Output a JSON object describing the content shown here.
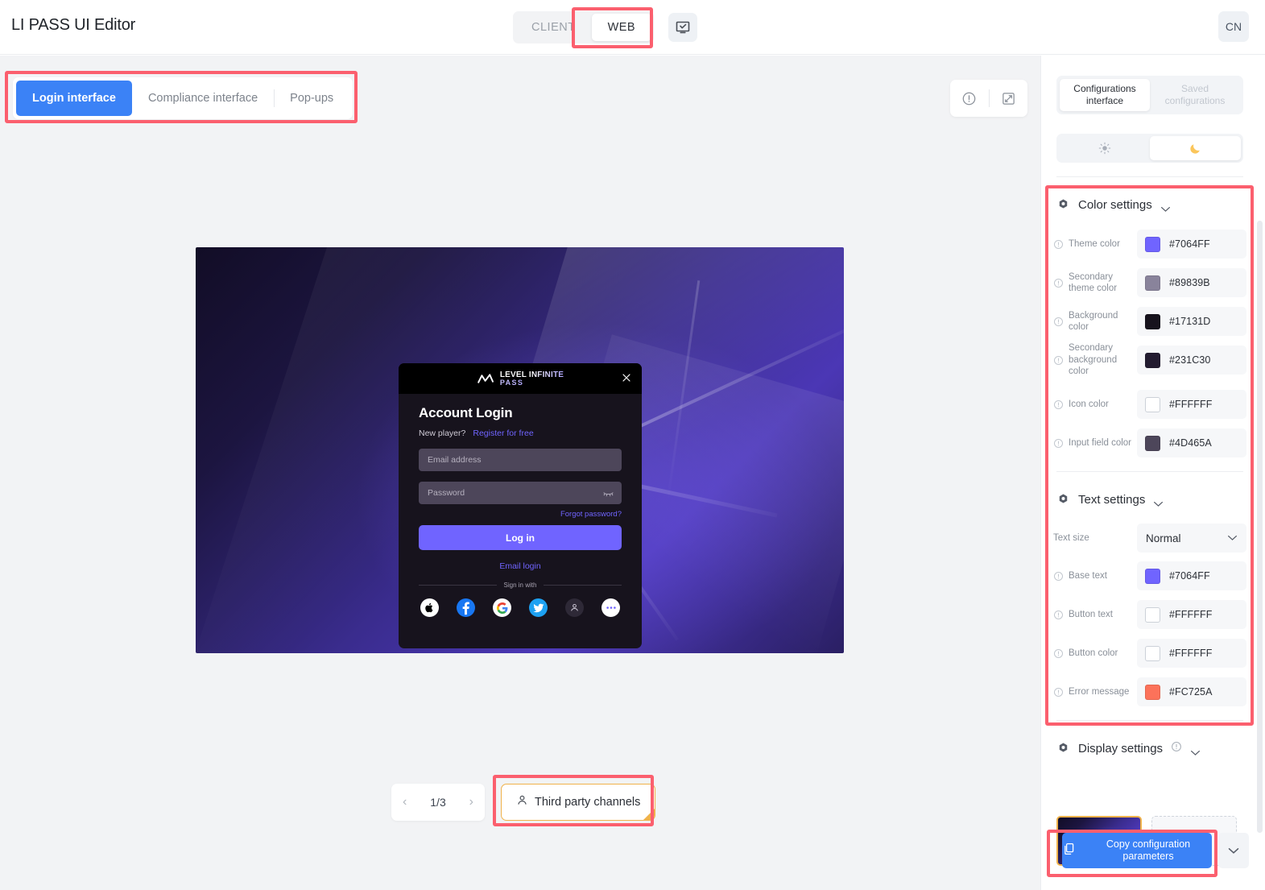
{
  "app": {
    "title": "LI PASS UI Editor"
  },
  "topbar": {
    "platforms": [
      {
        "label": "CLIENT",
        "active": false
      },
      {
        "label": "WEB",
        "active": true
      }
    ],
    "preview_icon": "monitor-check-icon",
    "language": "CN"
  },
  "canvas": {
    "tabs": [
      {
        "label": "Login interface",
        "active": true
      },
      {
        "label": "Compliance interface",
        "active": false
      },
      {
        "label": "Pop-ups",
        "active": false
      }
    ],
    "tools": [
      {
        "name": "info-icon"
      },
      {
        "name": "expand-icon"
      }
    ]
  },
  "preview": {
    "brand": {
      "line1": "LEVEL INFINITE",
      "line2": "PASS"
    },
    "close_icon": "close-icon",
    "title": "Account Login",
    "new_player_label": "New player?",
    "register_link": "Register for free",
    "email_placeholder": "Email address",
    "password_placeholder": "Password",
    "forgot_link": "Forgot password?",
    "login_button": "Log in",
    "email_login_link": "Email login",
    "sign_in_with": "Sign in with",
    "socials": [
      {
        "name": "apple-icon"
      },
      {
        "name": "facebook-icon"
      },
      {
        "name": "google-icon"
      },
      {
        "name": "twitter-icon"
      },
      {
        "name": "guest-account-icon"
      },
      {
        "name": "more-options-icon"
      }
    ]
  },
  "pager": {
    "prev_icon": "chevron-left-icon",
    "page_indicator": "1/3",
    "next_icon": "chevron-right-icon"
  },
  "third_party": {
    "icon": "person-icon",
    "label": "Third party channels"
  },
  "right_panel": {
    "tabs": [
      {
        "label": "Configurations interface",
        "active": true
      },
      {
        "label": "Saved configurations",
        "active": false
      }
    ],
    "mode_toggle": [
      {
        "name": "sun-icon",
        "active": false
      },
      {
        "name": "moon-icon",
        "active": true
      }
    ],
    "color_settings": {
      "title": "Color settings",
      "rows": [
        {
          "label": "Theme color",
          "hex": "#7064FF",
          "color": "#7064FF"
        },
        {
          "label": "Secondary theme color",
          "hex": "#89839B",
          "color": "#89839B"
        },
        {
          "label": "Background color",
          "hex": "#17131D",
          "color": "#17131D"
        },
        {
          "label": "Secondary background color",
          "hex": "#231C30",
          "color": "#231C30"
        },
        {
          "label": "Icon color",
          "hex": "#FFFFFF",
          "color": "#FFFFFF"
        },
        {
          "label": "Input field color",
          "hex": "#4D465A",
          "color": "#4D465A"
        }
      ]
    },
    "text_settings": {
      "title": "Text settings",
      "text_size_label": "Text size",
      "text_size_value": "Normal",
      "rows": [
        {
          "label": "Base text",
          "hex": "#7064FF",
          "color": "#7064FF"
        },
        {
          "label": "Button text",
          "hex": "#FFFFFF",
          "color": "#FFFFFF"
        },
        {
          "label": "Button color",
          "hex": "#FFFFFF",
          "color": "#FFFFFF"
        },
        {
          "label": "Error message",
          "hex": "#FC725A",
          "color": "#FC725A"
        }
      ]
    },
    "display_settings": {
      "title": "Display settings",
      "info_icon": "info-icon",
      "upload_icon": "upload-icon"
    },
    "copy_button": {
      "icon": "copy-icon",
      "label": "Copy configuration parameters"
    },
    "copy_more_icon": "chevron-down-icon"
  }
}
